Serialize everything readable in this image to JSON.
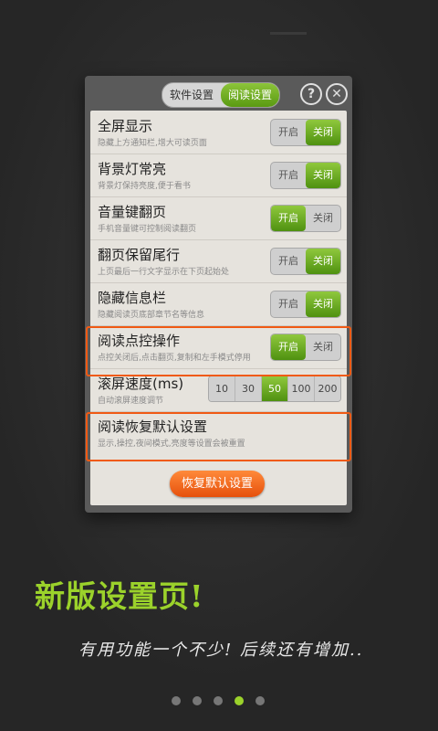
{
  "tabs": {
    "software": "软件设置",
    "reading": "阅读设置"
  },
  "header_icons": {
    "help": "?",
    "close": "✕"
  },
  "rows": [
    {
      "title": "全屏显示",
      "sub": "隐藏上方通知栏,增大可读页面",
      "on": "开启",
      "off": "关闭",
      "state": "off"
    },
    {
      "title": "背景灯常亮",
      "sub": "背景灯保持亮度,便于看书",
      "on": "开启",
      "off": "关闭",
      "state": "off"
    },
    {
      "title": "音量键翻页",
      "sub": "手机音量键可控制阅读翻页",
      "on": "开启",
      "off": "关闭",
      "state": "on"
    },
    {
      "title": "翻页保留尾行",
      "sub": "上页最后一行文字显示在下页起始处",
      "on": "开启",
      "off": "关闭",
      "state": "off"
    },
    {
      "title": "隐藏信息栏",
      "sub": "隐藏阅读页底部章节名等信息",
      "on": "开启",
      "off": "关闭",
      "state": "off"
    },
    {
      "title": "阅读点控操作",
      "sub": "点控关闭后,点击翻页,复制和左手模式停用",
      "on": "开启",
      "off": "关闭",
      "state": "on"
    }
  ],
  "speed": {
    "title": "滚屏速度(ms)",
    "sub": "自动滚屏速度调节",
    "options": [
      "10",
      "30",
      "50",
      "100",
      "200"
    ],
    "selected": "50"
  },
  "reset": {
    "title": "阅读恢复默认设置",
    "sub": "显示,操控,夜间模式,亮度等设置会被重置",
    "button": "恢复默认设置"
  },
  "headline": "新版设置页!",
  "tagline": "有用功能一个不少! 后续还有增加..",
  "pager": {
    "count": 5,
    "active": 3
  },
  "colors": {
    "accent_green": "#9bd22b",
    "highlight_orange": "#f05a14"
  }
}
